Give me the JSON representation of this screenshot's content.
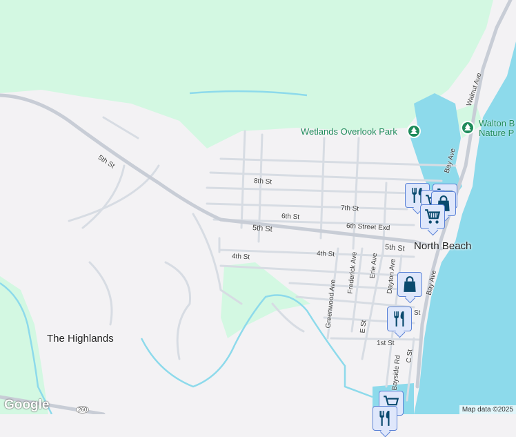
{
  "map": {
    "colors": {
      "land": "#f3f2f4",
      "park": "#d3f8e2",
      "water": "#8ddaeb",
      "road": "#d7dce3",
      "major_road": "#c8cdd6",
      "pin_bg": "#dfe7fb",
      "pin_border": "#5b82d6",
      "icon": "#0a4a6e",
      "park_label": "#1e8a5a"
    },
    "places": {
      "north_beach": "North Beach",
      "highlands": "The Highlands"
    },
    "parks": [
      {
        "name": "Wetlands Overlook Park",
        "icon": "tree-icon"
      },
      {
        "name_line1": "Walton B",
        "name_line2": "Nature P",
        "icon": "tree-icon"
      }
    ],
    "streets": {
      "fifth_st_west": "5th St",
      "fifth_st": "5th St",
      "fifth_st_east": "5th St",
      "eighth_st": "8th St",
      "seventh_st": "7th St",
      "sixth_st": "6th St",
      "sixth_st_exd": "6th Street Exd",
      "fourth_st": "4th St",
      "fourth_st_east": "4th St",
      "walnut_ave": "Walnut Ave",
      "bay_ave_north": "Bay Ave",
      "bay_ave_south": "Bay Ave",
      "greenwood_ave": "Greenwood Ave",
      "frederick_ave": "Frederick Ave",
      "erie_ave": "Erie Ave",
      "dayton_ave": "Dayton Ave",
      "e_st": "E St",
      "first_st": "1st St",
      "second_st": "St",
      "bayside_rd": "Bayside Rd",
      "c_st": "C St"
    },
    "route_shield": "260",
    "pins": [
      {
        "type": "restaurant",
        "icon": "fork-knife-icon"
      },
      {
        "type": "grocery",
        "icon": "shopping-cart-icon"
      },
      {
        "type": "grocery",
        "icon": "shopping-cart-icon"
      },
      {
        "type": "shopping",
        "icon": "shopping-bag-icon"
      },
      {
        "type": "grocery",
        "icon": "shopping-cart-icon"
      },
      {
        "type": "shopping",
        "icon": "shopping-bag-icon"
      },
      {
        "type": "restaurant",
        "icon": "fork-knife-icon"
      },
      {
        "type": "grocery",
        "icon": "shopping-cart-icon"
      },
      {
        "type": "restaurant",
        "icon": "fork-knife-icon"
      }
    ],
    "logo": "Google",
    "attribution": "Map data ©2025"
  }
}
